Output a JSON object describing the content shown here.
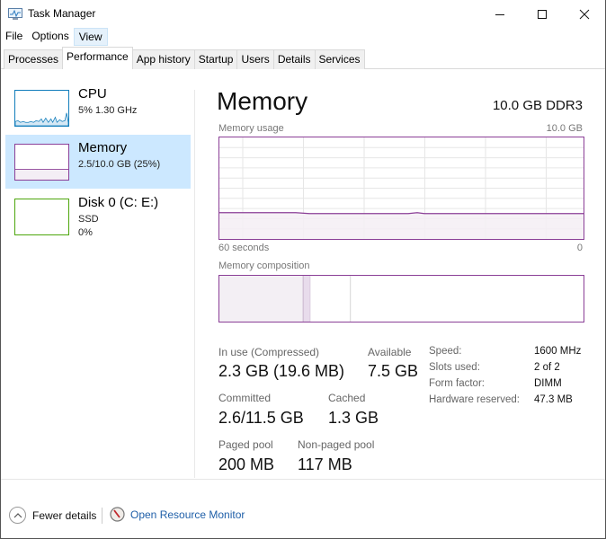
{
  "window": {
    "title": "Task Manager",
    "controls": {
      "minimize": "—",
      "maximize": "☐",
      "close": "✕"
    }
  },
  "menu": [
    "File",
    "Options",
    "View"
  ],
  "menu_active": "View",
  "tabs": [
    "Processes",
    "Performance",
    "App history",
    "Startup",
    "Users",
    "Details",
    "Services"
  ],
  "selected_tab": "Performance",
  "sidebar": {
    "items": [
      {
        "title": "CPU",
        "lines": [
          "5%  1.30 GHz"
        ],
        "color": "#117dbb"
      },
      {
        "title": "Memory",
        "lines": [
          "2.5/10.0 GB (25%)"
        ],
        "color": "#8b3f97",
        "selected": true
      },
      {
        "title": "Disk 0 (C: E:)",
        "lines": [
          "SSD",
          "0%"
        ],
        "color": "#4da60c"
      }
    ]
  },
  "main": {
    "title": "Memory",
    "spec": "10.0 GB DDR3",
    "usage_label": "Memory usage",
    "usage_max": "10.0 GB",
    "time_left": "60 seconds",
    "time_right": "0",
    "composition_label": "Memory composition",
    "usage_fraction": 0.25,
    "composition": {
      "in_use_gb": 2.3,
      "modified_gb": 0.2,
      "standby_gb": 1.1,
      "free_gb": 6.4,
      "total_gb": 10.0
    },
    "stats": {
      "in_use_label": "In use (Compressed)",
      "in_use_value": "2.3 GB (19.6 MB)",
      "available_label": "Available",
      "available_value": "7.5 GB",
      "committed_label": "Committed",
      "committed_value": "2.6/11.5 GB",
      "cached_label": "Cached",
      "cached_value": "1.3 GB",
      "paged_label": "Paged pool",
      "paged_value": "200 MB",
      "nonpaged_label": "Non-paged pool",
      "nonpaged_value": "117 MB"
    },
    "specs": [
      {
        "label": "Speed:",
        "value": "1600 MHz"
      },
      {
        "label": "Slots used:",
        "value": "2 of 2"
      },
      {
        "label": "Form factor:",
        "value": "DIMM"
      },
      {
        "label": "Hardware reserved:",
        "value": "47.3 MB"
      }
    ]
  },
  "footer": {
    "fewer_details": "Fewer details",
    "open_resmon": "Open Resource Monitor"
  },
  "colors": {
    "memory": "#8b3f97",
    "memory_fill": "#f4eef5",
    "cpu": "#117dbb",
    "disk": "#4da60c",
    "selected_bg": "#cce8ff",
    "link": "#1f5fa8"
  }
}
